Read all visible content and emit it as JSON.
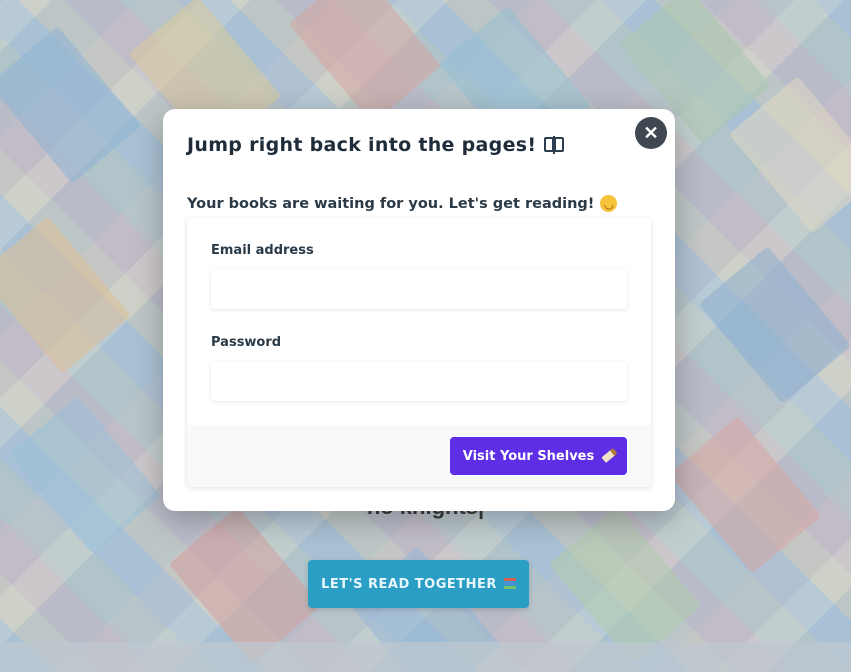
{
  "background": {
    "typed_text": "no knights|",
    "cta_label": "LET'S READ TOGETHER",
    "cta_icon": "stacked-books-icon"
  },
  "modal": {
    "title": "Jump right back into the pages!",
    "title_icon": "open-book-icon",
    "subtitle": "Your books are waiting for you. Let's get reading!",
    "subtitle_icon": "smiling-face-icon",
    "close_icon": "close-icon",
    "form": {
      "email_label": "Email address",
      "email_value": "",
      "password_label": "Password",
      "password_value": "",
      "submit_label": "Visit Your Shelves",
      "submit_icon": "bookmark-icon"
    }
  },
  "colors": {
    "submit_button": "#5d2ee6",
    "cta_button": "#2a9ec4",
    "close_button": "#3f4851",
    "heading_text": "#1f2d3a"
  }
}
